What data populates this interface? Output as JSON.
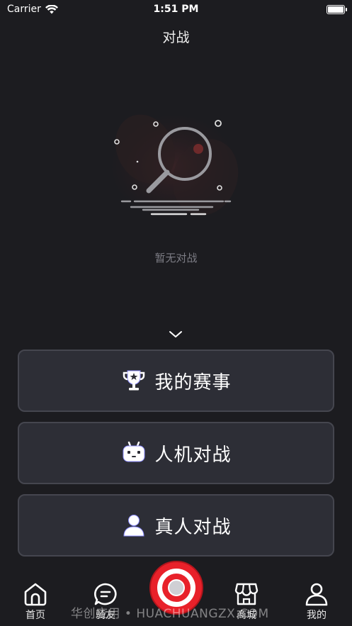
{
  "status_bar": {
    "carrier": "Carrier",
    "time": "1:51 PM"
  },
  "nav": {
    "title": "对战"
  },
  "empty_state": {
    "text": "暂无对战",
    "icon": "magnifier-icon"
  },
  "menu": {
    "items": [
      {
        "label": "我的赛事",
        "icon": "trophy-icon"
      },
      {
        "label": "人机对战",
        "icon": "robot-icon"
      },
      {
        "label": "真人对战",
        "icon": "person-icon"
      }
    ]
  },
  "tab_bar": {
    "items": [
      {
        "label": "首页",
        "icon": "home-icon"
      },
      {
        "label": "骑友",
        "icon": "chat-bubble-icon"
      },
      {
        "label": "",
        "icon": "target-icon"
      },
      {
        "label": "商城",
        "icon": "store-icon"
      },
      {
        "label": "我的",
        "icon": "user-icon"
      }
    ]
  },
  "watermark": "华创应用 • HUACHUANGZX.COM",
  "colors": {
    "background": "#1c1c20",
    "button_bg": "#2d2e36",
    "button_border": "#45464f",
    "accent_red": "#e8212a",
    "icon_glow": "#8c8cff"
  }
}
